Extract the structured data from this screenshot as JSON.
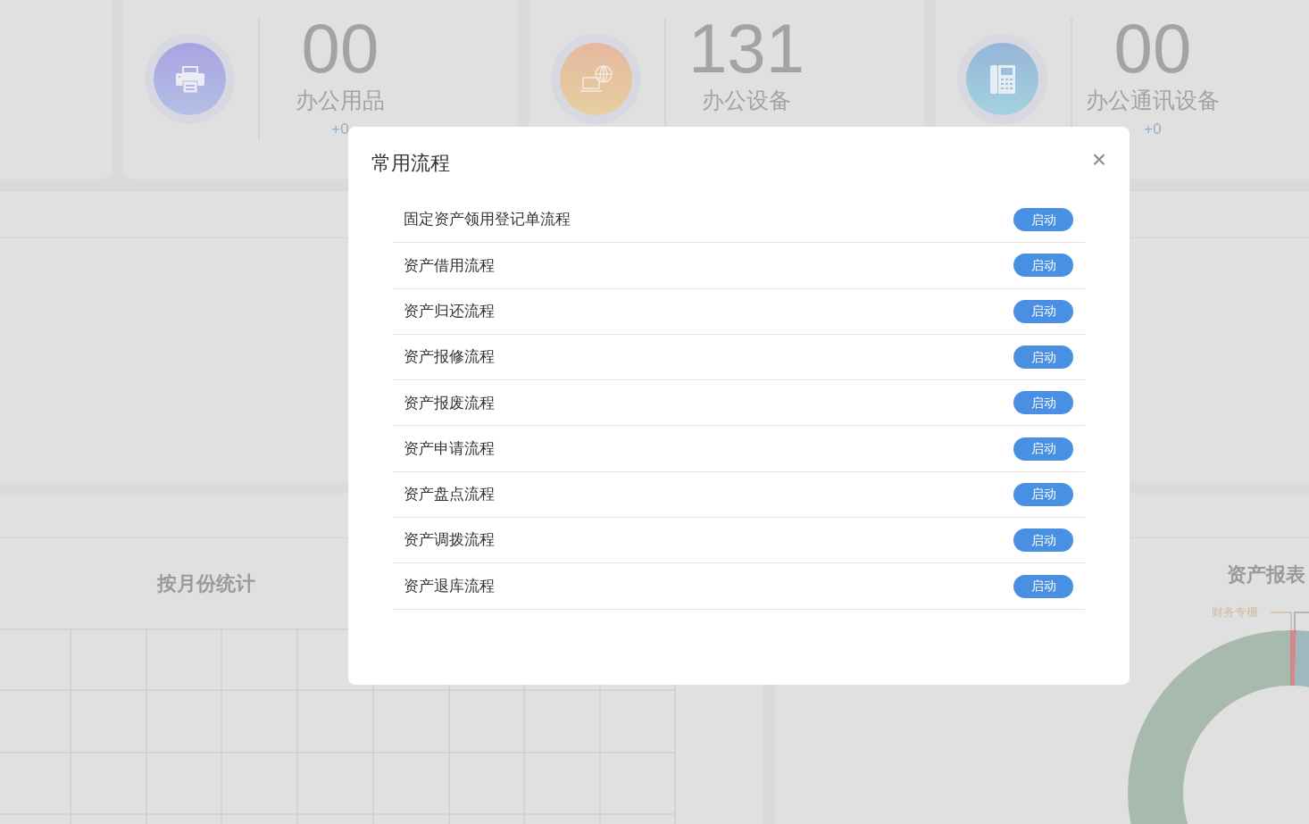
{
  "stat_cards": [
    {
      "kind": "empty"
    },
    {
      "kind": "stat",
      "value": "00",
      "label": "办公用品",
      "delta": "+0"
    },
    {
      "kind": "stat",
      "value": "131",
      "label": "办公设备"
    },
    {
      "kind": "stat",
      "value": "00",
      "label": "办公通讯设备",
      "delta": "+0"
    }
  ],
  "monthly_panel": {
    "title": "按月份统计"
  },
  "report_panel": {
    "title": "资产报表",
    "legend_label": "财务专栅"
  },
  "dialog": {
    "title": "常用流程",
    "close": "×",
    "items": [
      {
        "label": "固定资产领用登记单流程",
        "button": "启动"
      },
      {
        "label": "资产借用流程",
        "button": "启动"
      },
      {
        "label": "资产归还流程",
        "button": "启动"
      },
      {
        "label": "资产报修流程",
        "button": "启动"
      },
      {
        "label": "资产报废流程",
        "button": "启动"
      },
      {
        "label": "资产申请流程",
        "button": "启动"
      },
      {
        "label": "资产盘点流程",
        "button": "启动"
      },
      {
        "label": "资产调拨流程",
        "button": "启动"
      },
      {
        "label": "资产退库流程",
        "button": "启动"
      }
    ]
  }
}
